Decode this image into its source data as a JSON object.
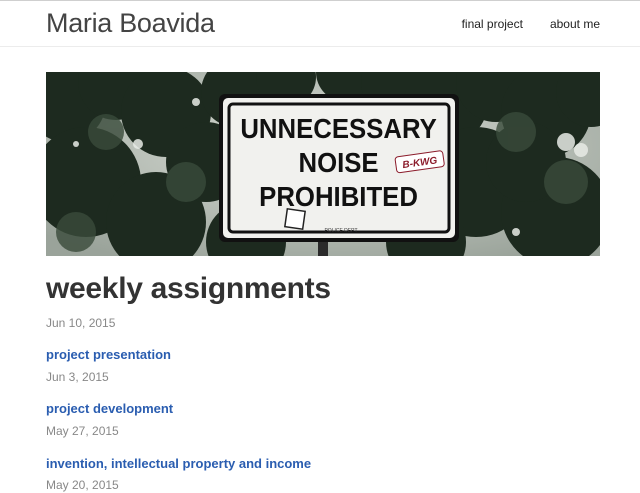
{
  "site": {
    "title": "Maria Boavida"
  },
  "nav": {
    "items": [
      {
        "label": "final project"
      },
      {
        "label": "about me"
      }
    ]
  },
  "banner": {
    "sign_lines": [
      "UNNECESSARY",
      "NOISE",
      "PROHIBITED"
    ],
    "sticker_text": "B-KWG",
    "small_text": "POLICE DEPT"
  },
  "main": {
    "heading": "weekly assignments",
    "heading_date": "Jun 10, 2015",
    "posts": [
      {
        "title": "project presentation",
        "date": "Jun 3, 2015"
      },
      {
        "title": "project development",
        "date": "May 27, 2015"
      },
      {
        "title": "invention, intellectual property and income",
        "date": "May 20, 2015"
      }
    ]
  },
  "colors": {
    "link": "#2a5db0",
    "date": "#888888",
    "text": "#333333"
  }
}
